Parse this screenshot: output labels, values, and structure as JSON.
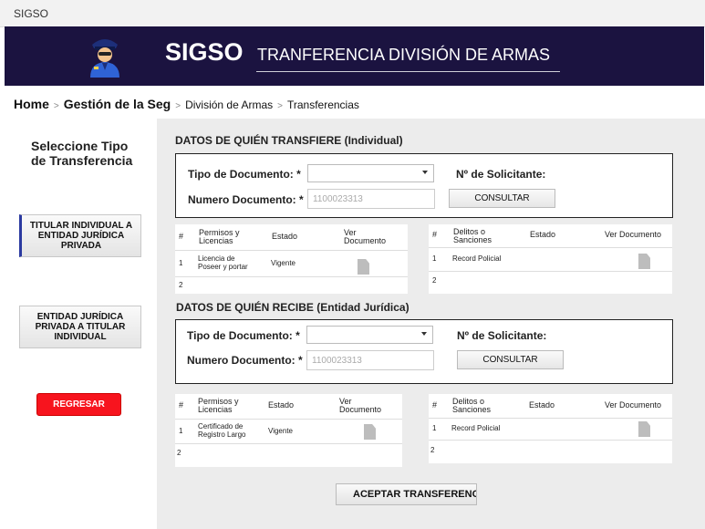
{
  "window": {
    "title": "SIGSO"
  },
  "header": {
    "app_name": "SIGSO",
    "subtitle": "TRANFERENCIA DIVISIÓN DE ARMAS",
    "logo_icon": "police-officer-icon"
  },
  "breadcrumb": [
    "Home",
    "Gestión de la Seg",
    "División de Armas",
    "Transferencias"
  ],
  "sidebar": {
    "title": "Seleccione Tipo de Transferencia",
    "options": [
      {
        "label": "TITULAR INDIVIDUAL A ENTIDAD JURÍDICA PRIVADA",
        "active": true
      },
      {
        "label": "ENTIDAD JURÍDICA PRIVADA A TITULAR INDIVIDUAL",
        "active": false
      }
    ],
    "back_label": "REGRESAR"
  },
  "transfiere": {
    "title": "DATOS DE QUIÉN TRANSFIERE (Individual)",
    "doc_type_label": "Tipo de Documento: *",
    "doc_type_value": "",
    "doc_number_label": "Numero Documento: *",
    "doc_number_placeholder": "1100023313",
    "requester_label": "Nº de Solicitante:",
    "consult_label": "CONSULTAR",
    "permisos": {
      "headers": [
        "#",
        "Permisos y Licencias",
        "Estado",
        "Ver Documento"
      ],
      "rows": [
        {
          "n": "1",
          "permiso": "Licencia de Poseer y portar",
          "estado": "Vigente",
          "doc": "document-icon"
        },
        {
          "n": "2",
          "permiso": "",
          "estado": "",
          "doc": ""
        }
      ]
    },
    "delitos": {
      "headers": [
        "#",
        "Delitos o Sanciones",
        "Estado",
        "Ver Documento"
      ],
      "rows": [
        {
          "n": "1",
          "delito": "Record Policial",
          "estado": "",
          "doc": "document-icon"
        },
        {
          "n": "2",
          "delito": "",
          "estado": "",
          "doc": ""
        }
      ]
    }
  },
  "recibe": {
    "title": "DATOS DE QUIÉN RECIBE (Entidad Jurídica)",
    "doc_type_label": "Tipo de Documento: *",
    "doc_type_value": "",
    "doc_number_label": "Numero Documento: *",
    "doc_number_placeholder": "1100023313",
    "requester_label": "Nº de Solicitante:",
    "consult_label": "CONSULTAR",
    "permisos": {
      "headers": [
        "#",
        "Permisos y Licencias",
        "Estado",
        "Ver Documento"
      ],
      "rows": [
        {
          "n": "1",
          "permiso": "Certificado de Registro Largo",
          "estado": "Vigente",
          "doc": "document-icon"
        },
        {
          "n": "2",
          "permiso": "",
          "estado": "",
          "doc": ""
        }
      ]
    },
    "delitos": {
      "headers": [
        "#",
        "Delitos o Sanciones",
        "Estado",
        "Ver Documento"
      ],
      "rows": [
        {
          "n": "1",
          "delito": "Record Policial",
          "estado": "",
          "doc": "document-icon"
        },
        {
          "n": "2",
          "delito": "",
          "estado": "",
          "doc": ""
        }
      ]
    }
  },
  "accept_label": "ACEPTAR TRANSFERENCIA",
  "colors": {
    "banner": "#1b1340",
    "back_button": "#f7141e",
    "panel_bg": "#ececec",
    "active_accent": "#2b3aa0"
  }
}
